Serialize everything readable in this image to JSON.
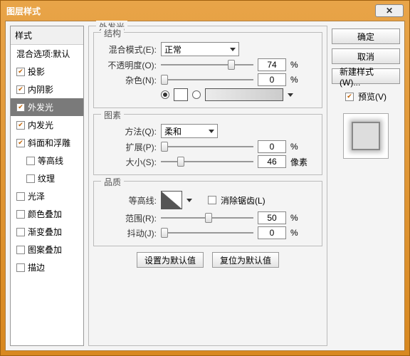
{
  "title": "图层样式",
  "close": "×",
  "sidebar": {
    "head": "样式",
    "blend": "混合选项:默认",
    "items": [
      {
        "label": "投影",
        "checked": true
      },
      {
        "label": "内阴影",
        "checked": true
      },
      {
        "label": "外发光",
        "checked": true,
        "selected": true
      },
      {
        "label": "内发光",
        "checked": true
      },
      {
        "label": "斜面和浮雕",
        "checked": true
      },
      {
        "label": "等高线",
        "checked": false,
        "indent": true
      },
      {
        "label": "纹理",
        "checked": false,
        "indent": true
      },
      {
        "label": "光泽",
        "checked": false
      },
      {
        "label": "颜色叠加",
        "checked": false
      },
      {
        "label": "渐变叠加",
        "checked": false
      },
      {
        "label": "图案叠加",
        "checked": false
      },
      {
        "label": "描边",
        "checked": false
      }
    ]
  },
  "panel": {
    "title": "外发光",
    "g1": {
      "title": "结构",
      "blend_label": "混合模式(E):",
      "blend_value": "正常",
      "opacity_label": "不透明度(O):",
      "opacity_value": "74",
      "pct": "%",
      "noise_label": "杂色(N):",
      "noise_value": "0",
      "color_label": "颜色:",
      "swatch": "#ffffff"
    },
    "g2": {
      "title": "图素",
      "tech_label": "方法(Q):",
      "tech_value": "柔和",
      "spread_label": "扩展(P):",
      "spread_value": "0",
      "size_label": "大小(S):",
      "size_value": "46",
      "px": "像素"
    },
    "g3": {
      "title": "品质",
      "contour_label": "等高线:",
      "aa_label": "消除锯齿(L)",
      "range_label": "范围(R):",
      "range_value": "50",
      "jitter_label": "抖动(J):",
      "jitter_value": "0"
    },
    "defaults_set": "设置为默认值",
    "defaults_reset": "复位为默认值"
  },
  "right": {
    "ok": "确定",
    "cancel": "取消",
    "newstyle": "新建样式(W)...",
    "preview": "预览(V)"
  }
}
